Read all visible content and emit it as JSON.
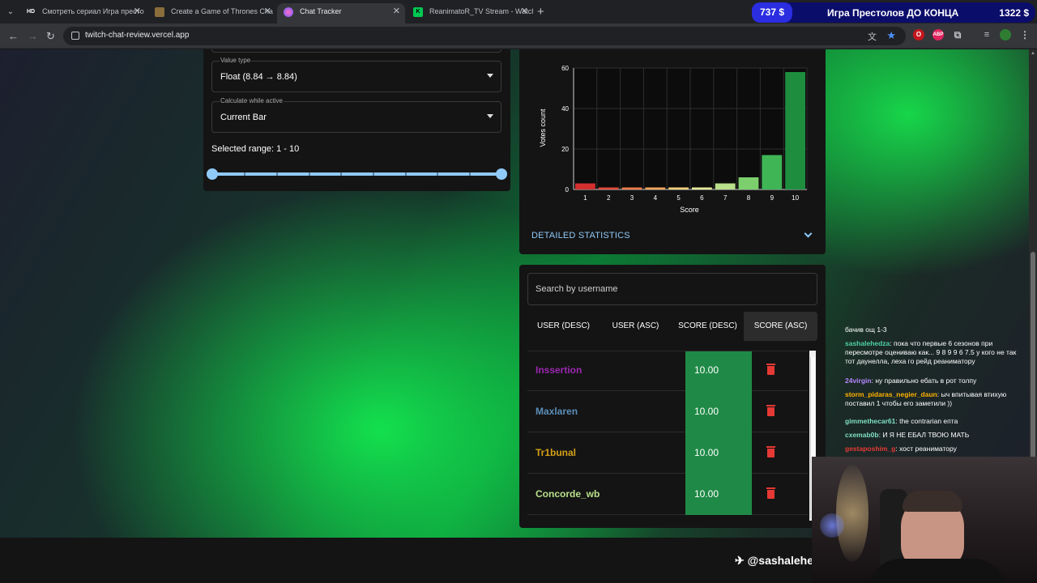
{
  "browser": {
    "tabs": [
      {
        "favicon": "HD",
        "favicon_color": "#35363a",
        "title": "Смотреть сериал Игра престо",
        "active": false
      },
      {
        "favicon": "",
        "favicon_color": "#8a6d3b",
        "title": "Create a Game of Thrones Cha",
        "active": false
      },
      {
        "favicon": "",
        "favicon_color": "#9c4dcc",
        "title": "Chat Tracker",
        "active": true
      },
      {
        "favicon": "K",
        "favicon_color": "#00c853",
        "title": "ReanimatoR_TV Stream - Watch",
        "active": false
      }
    ],
    "url": "twitch-chat-review.vercel.app"
  },
  "stream_overlay": {
    "left_amount": "737 $",
    "title": "Игра Престолов ДО КОНЦА",
    "right_amount": "1322 $"
  },
  "settings": {
    "value_type": {
      "label": "Value type",
      "value": "Float (8.84 → 8.84)"
    },
    "calculate_while_active": {
      "label": "Calculate while active",
      "value": "Current Bar"
    },
    "selected_range": "Selected range: 1 - 10",
    "range_min": 1,
    "range_max": 10
  },
  "chart_data": {
    "type": "bar",
    "categories": [
      "1",
      "2",
      "3",
      "4",
      "5",
      "6",
      "7",
      "8",
      "9",
      "10"
    ],
    "values": [
      3,
      1,
      1,
      1,
      1,
      1,
      3,
      6,
      17,
      58
    ],
    "colors": [
      "#d32f2f",
      "#e64a39",
      "#f07a4a",
      "#f5a55a",
      "#f5d17a",
      "#e8ec9a",
      "#b9e08a",
      "#7ccf6c",
      "#3fb556",
      "#1e8e3e"
    ],
    "xlabel": "Score",
    "ylabel": "Votes count",
    "ylim": [
      0,
      60
    ],
    "yticks": [
      0,
      20,
      40,
      60
    ],
    "grid": true
  },
  "detailed_statistics_label": "DETAILED STATISTICS",
  "users": {
    "search_placeholder": "Search by username",
    "sort_buttons": [
      "USER (DESC)",
      "USER (ASC)",
      "SCORE (DESC)",
      "SCORE (ASC)"
    ],
    "selected_sort": "SCORE (ASC)",
    "rows": [
      {
        "name": "Inssertion",
        "color": "#9c27b0",
        "score": "10.00"
      },
      {
        "name": "Maxlaren",
        "color": "#5b8db8",
        "score": "10.00"
      },
      {
        "name": "Tr1bunal",
        "color": "#d4a017",
        "score": "10.00"
      },
      {
        "name": "Concorde_wb",
        "color": "#b8e08a",
        "score": "10.00"
      }
    ]
  },
  "chat": [
    {
      "nick": "",
      "nick_color": "#ffffff",
      "text": "бачив ощ 1-3"
    },
    {
      "nick": "sashalehedza",
      "nick_color": "#4fd1a6",
      "text": ": пока что первые 6 сезонов при пересмотре оцениваю как... 9 8 9 9 6 7.5 у кого не так тот даунелла, леха го рейд реаниматору"
    },
    {
      "nick": "24virgin",
      "nick_color": "#b388ff",
      "text": ": ну правильно ебать в рот толпу"
    },
    {
      "nick": "storm_pidaras_negier_daun",
      "nick_color": "#ffb300",
      "text": ": ыч впитывая втихую поставил 1 чтобы его заметили ))"
    },
    {
      "nick": "gimmethecar61",
      "nick_color": "#7ee0c0",
      "text": ": the contrarian епта"
    },
    {
      "nick": "cxemab0b",
      "nick_color": "#7ee0c0",
      "text": ": И Я НЕ ЕБАЛ ТВОЮ МАТЬ"
    },
    {
      "nick": "gestaposhim_g",
      "nick_color": "#e53935",
      "text": ": хост реаниматору"
    }
  ],
  "footer_handle": "@sashalehed"
}
